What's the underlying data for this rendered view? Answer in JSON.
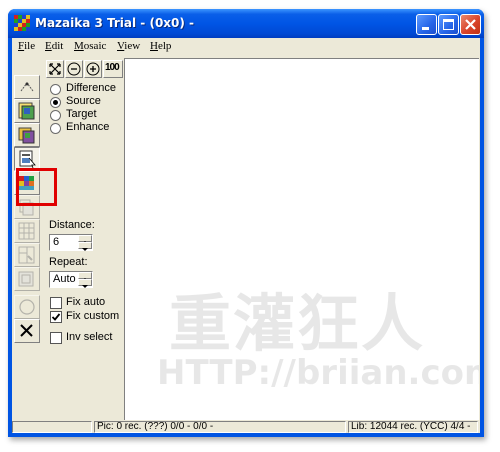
{
  "window": {
    "title": "Mazaika 3 Trial - (0x0) -",
    "minimize_icon": "minimize-icon",
    "maximize_icon": "maximize-icon",
    "close_icon": "close-icon"
  },
  "menu": {
    "items": [
      {
        "label": "File",
        "key": "F",
        "rest": "ile"
      },
      {
        "label": "Edit",
        "key": "E",
        "rest": "dit"
      },
      {
        "label": "Mosaic",
        "key": "M",
        "rest": "osaic"
      },
      {
        "label": "View",
        "key": "V",
        "rest": "iew"
      },
      {
        "label": "Help",
        "key": "H",
        "rest": "elp"
      }
    ]
  },
  "view_tools": [
    "fit-icon",
    "zoom-out-icon",
    "zoom-in-icon",
    "actual-size-icon"
  ],
  "view_tools_text": {
    "actual_size": "100"
  },
  "left_tools": [
    "wizard-icon",
    "open-source-icon",
    "open-target-icon",
    "library-icon",
    "color-palette-icon",
    "copy-icon",
    "grid-icon",
    "edit-tiles-icon",
    "render-icon",
    "circle-icon",
    "close-x-icon"
  ],
  "mode": {
    "options": [
      "Difference",
      "Source",
      "Target",
      "Enhance"
    ],
    "selected": "Source"
  },
  "distance": {
    "label": "Distance:",
    "value": "6"
  },
  "repeat": {
    "label": "Repeat:",
    "value": "Auto"
  },
  "checks": [
    {
      "label": "Fix auto",
      "checked": false
    },
    {
      "label": "Fix custom",
      "checked": true
    },
    {
      "label": "Inv select",
      "checked": false
    }
  ],
  "watermark": {
    "text_cn": "重灌狂人",
    "url": "HTTP://briian.com"
  },
  "status": {
    "pic": "Pic: 0 rec. (???) 0/0 - 0/0 -",
    "lib": "Lib: 12044 rec. (YCC) 4/4 -"
  },
  "colors": {
    "highlight_box": "#e00000",
    "title_blue": "#0054e3"
  }
}
